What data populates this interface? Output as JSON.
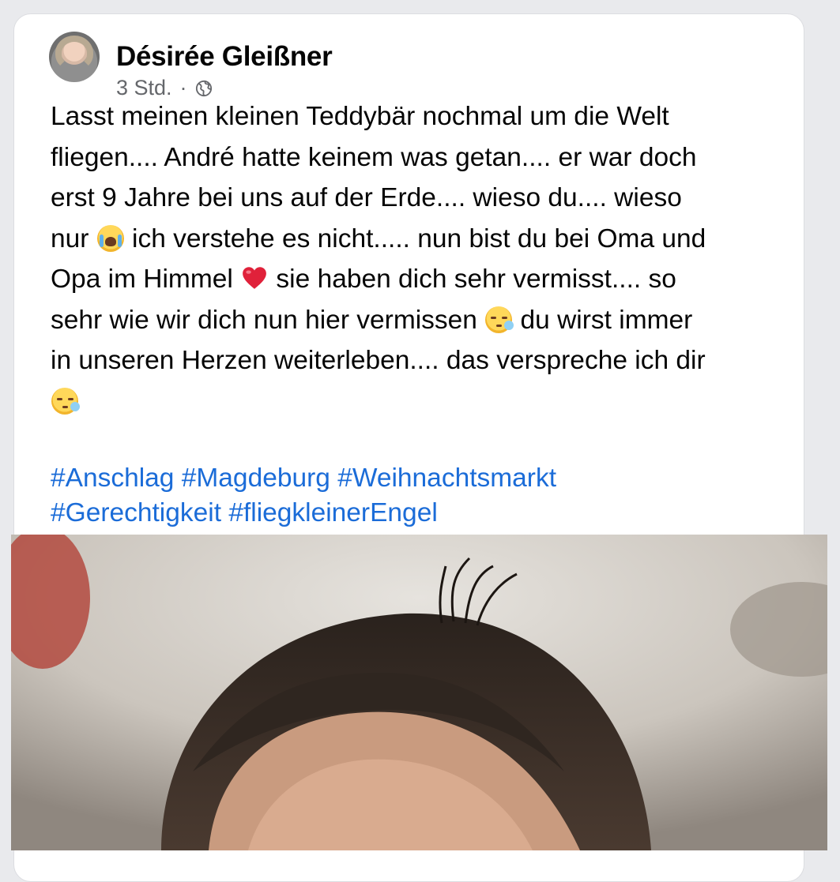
{
  "post": {
    "author": "Désirée Gleißner",
    "time": "3 Std.",
    "separator": "·",
    "privacy_icon": "globe-icon",
    "text_segments": [
      "Lasst meinen kleinen Teddybär nochmal um die Welt\nfliegen.... André hatte keinem was getan.... er war doch\nerst 9 Jahre bei uns auf der Erde.... wieso du.... wieso\nnur ",
      " ich verstehe es nicht..... nun bist du bei Oma und\nOpa im Himmel ",
      " sie haben dich sehr vermisst.... so\nsehr wie wir dich nun hier vermissen ",
      " du wirst immer\nin unseren Herzen weiterleben.... das verspreche ich dir\n"
    ],
    "hashtags": [
      "#Anschlag",
      "#Magdeburg",
      "#Weihnachtsmarkt",
      "#Gerechtigkeit",
      "#fliegkleinerEngel"
    ],
    "emojis": [
      "loudly-crying-face-icon",
      "red-heart-icon",
      "sleepy-face-icon",
      "sleepy-face-icon"
    ]
  },
  "colors": {
    "hashtag": "#1b6cd8",
    "meta_text": "#65676b",
    "background": "#e9eaed"
  }
}
